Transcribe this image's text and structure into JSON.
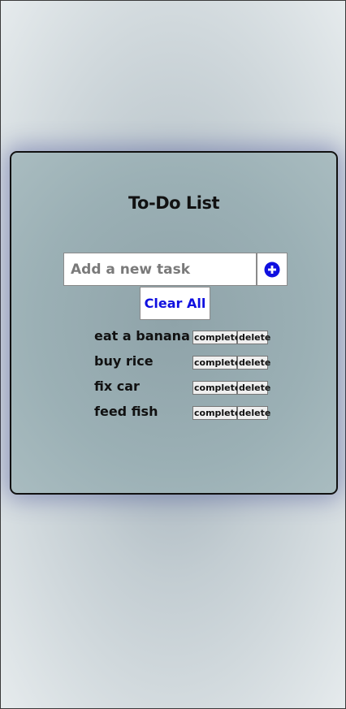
{
  "app": {
    "title": "To-Do List"
  },
  "input": {
    "placeholder": "Add a new task",
    "value": ""
  },
  "buttons": {
    "add_icon": "plus-circle-icon",
    "clear_all_label": "Clear All",
    "complete_label": "complete",
    "delete_label": "delete"
  },
  "tasks": [
    {
      "text": "eat a banana"
    },
    {
      "text": "buy rice"
    },
    {
      "text": "fix car"
    },
    {
      "text": "feed fish"
    }
  ],
  "colors": {
    "accent": "#1010e0",
    "card_border": "#111111"
  }
}
